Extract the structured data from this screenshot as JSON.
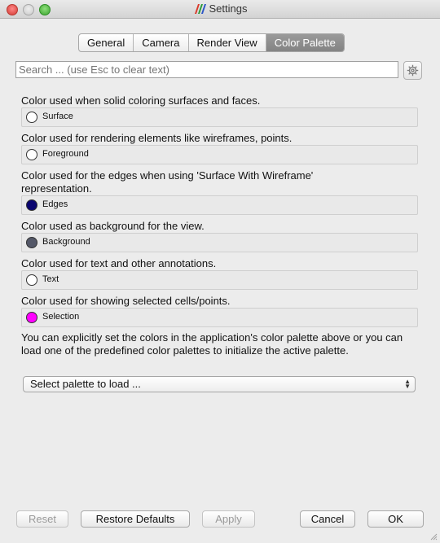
{
  "window": {
    "title": "Settings"
  },
  "tabs": [
    {
      "label": "General",
      "active": false
    },
    {
      "label": "Camera",
      "active": false
    },
    {
      "label": "Render View",
      "active": false
    },
    {
      "label": "Color Palette",
      "active": true
    }
  ],
  "search": {
    "placeholder": "Search ... (use Esc to clear text)",
    "value": ""
  },
  "colors": [
    {
      "description": "Color used when solid coloring surfaces and faces.",
      "name": "Surface",
      "color": "#ffffff"
    },
    {
      "description": "Color used for rendering elements like wireframes, points.",
      "name": "Foreground",
      "color": "#ffffff"
    },
    {
      "description": "Color used for the edges when using 'Surface With Wireframe' representation.",
      "name": "Edges",
      "color": "#0a0570"
    },
    {
      "description": "Color used as background for the view.",
      "name": "Background",
      "color": "#545868"
    },
    {
      "description": "Color used for text and other annotations.",
      "name": "Text",
      "color": "#ffffff"
    },
    {
      "description": "Color used for showing selected cells/points.",
      "name": "Selection",
      "color": "#ff00ff"
    }
  ],
  "info_text": "You can explicitly set the colors in the application's color palette above or you can load one of the predefined color palettes to initialize the active palette.",
  "palette_select": {
    "value": "Select palette to load ..."
  },
  "buttons": {
    "reset": "Reset",
    "restore_defaults": "Restore Defaults",
    "apply": "Apply",
    "cancel": "Cancel",
    "ok": "OK"
  }
}
